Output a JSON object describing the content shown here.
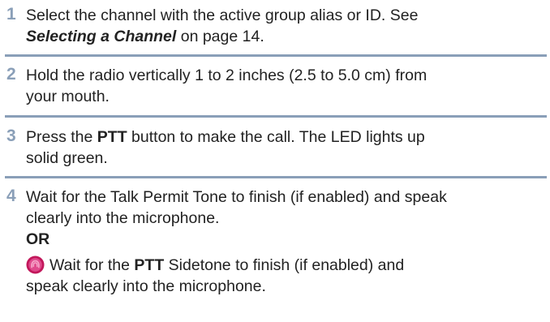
{
  "steps": [
    {
      "number": "1",
      "text_1": "Select the channel with the active group alias or ID. See",
      "link_text": "Selecting a Channel",
      "text_2": " on page 14."
    },
    {
      "number": "2",
      "text_1": "Hold the radio vertically 1 to 2 inches (2.5 to 5.0 cm) from",
      "text_2": "your mouth."
    },
    {
      "number": "3",
      "text_1": "Press the ",
      "bold": "PTT",
      "text_2": " button to make the call. The LED lights up",
      "text_3": "solid green."
    },
    {
      "number": "4",
      "text_1": "Wait for the Talk Permit Tone to finish (if enabled) and speak",
      "text_2": "clearly into the microphone.",
      "or_label": "OR",
      "alt_text_1": "Wait for the ",
      "alt_bold": "PTT",
      "alt_text_2": " Sidetone to finish (if enabled) and",
      "alt_text_3": "speak clearly into the microphone.",
      "alt_icon": "sidetone-icon"
    }
  ],
  "colors": {
    "accent": "#8a9fb8",
    "icon_fill": "#c2185b",
    "icon_ring": "#f5a3c7"
  }
}
